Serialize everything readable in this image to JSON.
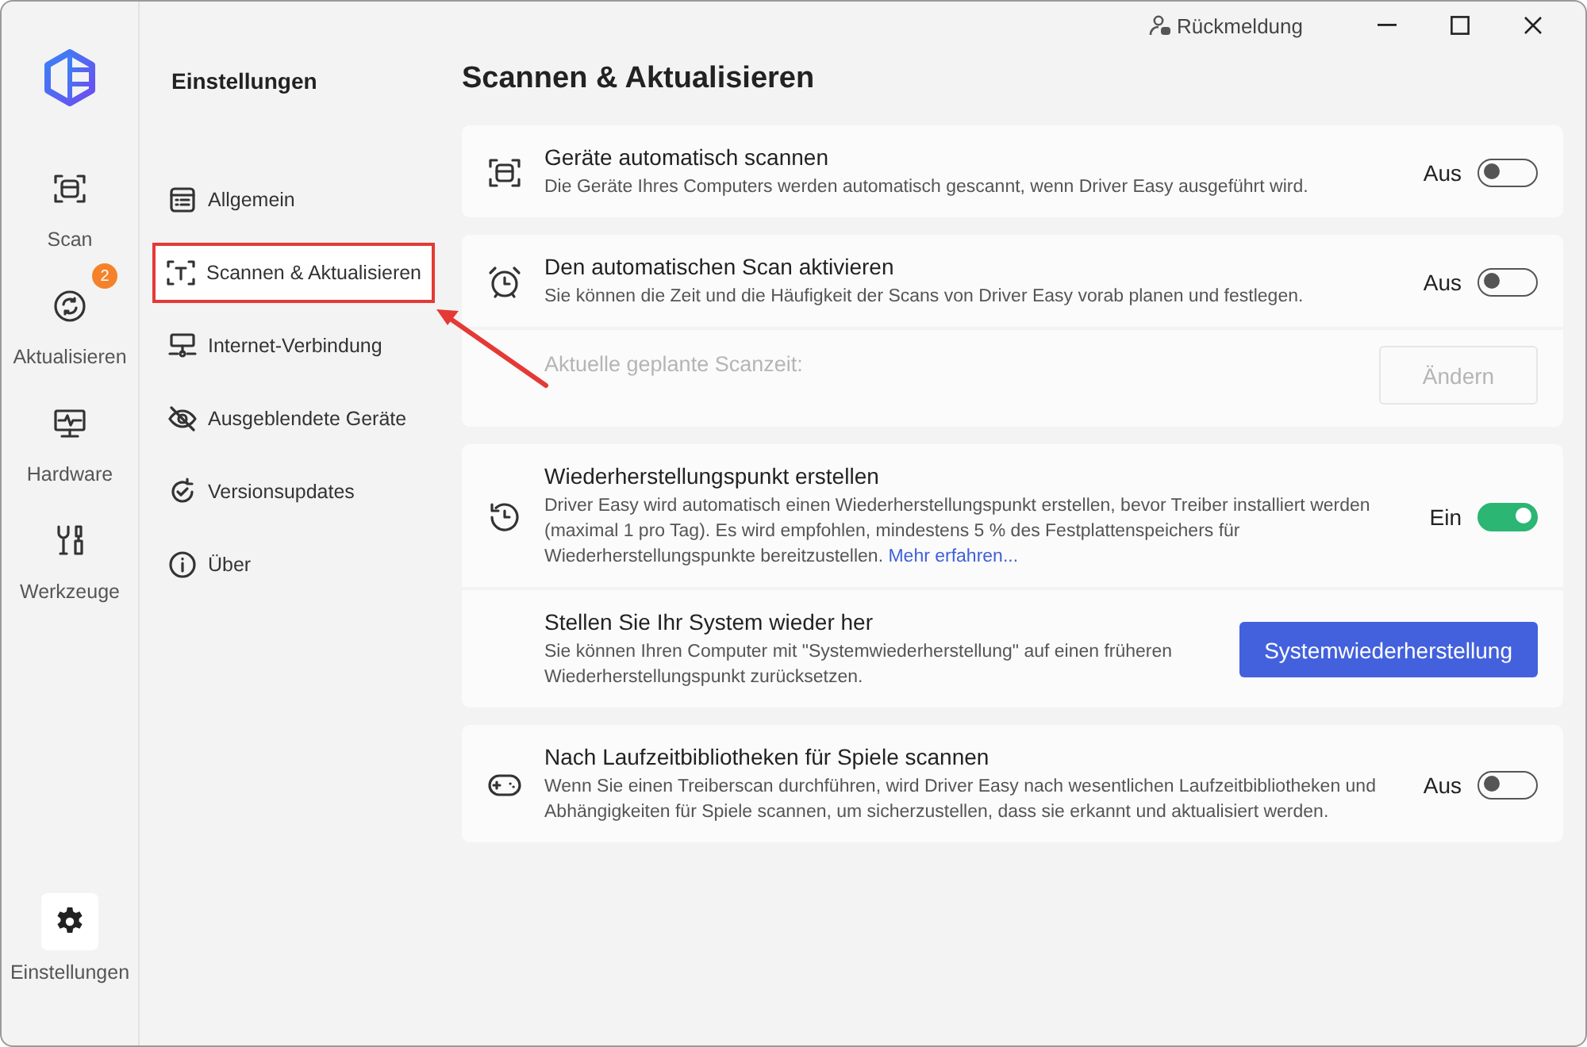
{
  "title_bar": {
    "feedback": "Rückmeldung"
  },
  "rail": {
    "items": [
      {
        "label": "Scan",
        "selected": false
      },
      {
        "label": "Aktualisieren",
        "selected": false,
        "badge": "2"
      },
      {
        "label": "Hardware",
        "selected": false
      },
      {
        "label": "Werkzeuge",
        "selected": false
      }
    ],
    "footer": {
      "label": "Einstellungen",
      "selected": true
    }
  },
  "settings_nav": {
    "title": "Einstellungen",
    "items": [
      {
        "label": "Allgemein",
        "selected": false,
        "highlighted": false
      },
      {
        "label": "Scannen & Aktualisieren",
        "selected": true,
        "highlighted": true
      },
      {
        "label": "Internet-Verbindung",
        "selected": false,
        "highlighted": false
      },
      {
        "label": "Ausgeblendete Geräte",
        "selected": false,
        "highlighted": false
      },
      {
        "label": "Versionsupdates",
        "selected": false,
        "highlighted": false
      },
      {
        "label": "Über",
        "selected": false,
        "highlighted": false
      }
    ]
  },
  "content": {
    "title": "Scannen & Aktualisieren",
    "cards": [
      {
        "rows": [
          {
            "kind": "toggle",
            "title": "Geräte automatisch scannen",
            "description": "Die Geräte Ihres Computers werden automatisch gescannt, wenn Driver Easy ausgeführt wird.",
            "state_label": "Aus",
            "on": false
          }
        ]
      },
      {
        "rows": [
          {
            "kind": "toggle",
            "title": "Den automatischen Scan aktivieren",
            "description": "Sie können die Zeit und die Häufigkeit der Scans von Driver Easy vorab planen und festlegen.",
            "state_label": "Aus",
            "on": false
          },
          {
            "kind": "schedule",
            "label": "Aktuelle geplante Scanzeit:",
            "button": "Ändern",
            "disabled": true
          }
        ]
      },
      {
        "rows": [
          {
            "kind": "toggle",
            "title": "Wiederherstellungspunkt erstellen",
            "description": "Driver Easy wird automatisch einen Wiederherstellungspunkt erstellen, bevor Treiber installiert werden (maximal 1 pro Tag). Es wird empfohlen, mindestens 5 % des Festplattenspeichers für Wiederherstellungspunkte bereitzustellen.",
            "link": "Mehr erfahren...",
            "state_label": "Ein",
            "on": true
          },
          {
            "kind": "action",
            "title": "Stellen Sie Ihr System wieder her",
            "description": "Sie können Ihren Computer mit \"Systemwiederherstellung\" auf einen früheren Wiederherstellungspunkt zurücksetzen.",
            "button": "Systemwiederherstellung"
          }
        ]
      },
      {
        "rows": [
          {
            "kind": "toggle",
            "title": "Nach Laufzeitbibliotheken für Spiele scannen",
            "description": "Wenn Sie einen Treiberscan durchführen, wird Driver Easy nach wesentlichen Laufzeitbibliotheken und Abhängigkeiten für Spiele scannen, um sicherzustellen, dass sie erkannt und aktualisiert werden.",
            "state_label": "Aus",
            "on": false
          }
        ]
      }
    ]
  }
}
